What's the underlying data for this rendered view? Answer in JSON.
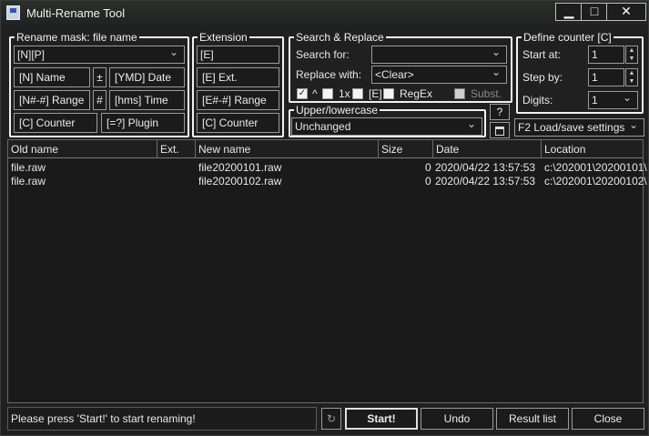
{
  "window": {
    "title": "Multi-Rename Tool"
  },
  "rename_mask": {
    "legend": "Rename mask: file name",
    "value": "[N][P]",
    "buttons": {
      "name": "[N] Name",
      "plusminus": "±",
      "date": "[YMD] Date",
      "range": "[N#-#] Range",
      "hash": "#",
      "time": "[hms] Time",
      "counter": "[C] Counter",
      "plugin": "[=?] Plugin"
    }
  },
  "extension": {
    "legend": "Extension",
    "value": "[E]",
    "buttons": {
      "ext": "[E] Ext.",
      "range": "[E#-#] Range",
      "counter": "[C] Counter"
    }
  },
  "search_replace": {
    "legend": "Search & Replace",
    "search_label": "Search for:",
    "search_value": "",
    "replace_label": "Replace with:",
    "replace_value": "<Clear>",
    "opt_caret": "^",
    "opt_once": "1x",
    "opt_ext": "[E]",
    "opt_regex": "RegEx",
    "opt_subst": "Subst."
  },
  "case": {
    "legend": "Upper/lowercase",
    "value": "Unchanged",
    "help": "?"
  },
  "counter": {
    "legend": "Define counter [C]",
    "start_label": "Start at:",
    "start_value": "1",
    "step_label": "Step by:",
    "step_value": "1",
    "digits_label": "Digits:",
    "digits_value": "1"
  },
  "settings": {
    "label": "F2 Load/save settings"
  },
  "list": {
    "columns": [
      "Old name",
      "Ext.",
      "New name",
      "Size",
      "Date",
      "Location"
    ],
    "rows": [
      {
        "old": "file.raw",
        "ext": "",
        "new": "file20200101.raw",
        "size": "0",
        "date": "2020/04/22 13:57:53",
        "location": "c:\\202001\\20200101\\"
      },
      {
        "old": "file.raw",
        "ext": "",
        "new": "file20200102.raw",
        "size": "0",
        "date": "2020/04/22 13:57:53",
        "location": "c:\\202001\\20200102\\"
      }
    ]
  },
  "status": "Please press 'Start!' to start renaming!",
  "buttons": {
    "start": "Start!",
    "undo": "Undo",
    "result": "Result list",
    "close": "Close"
  }
}
